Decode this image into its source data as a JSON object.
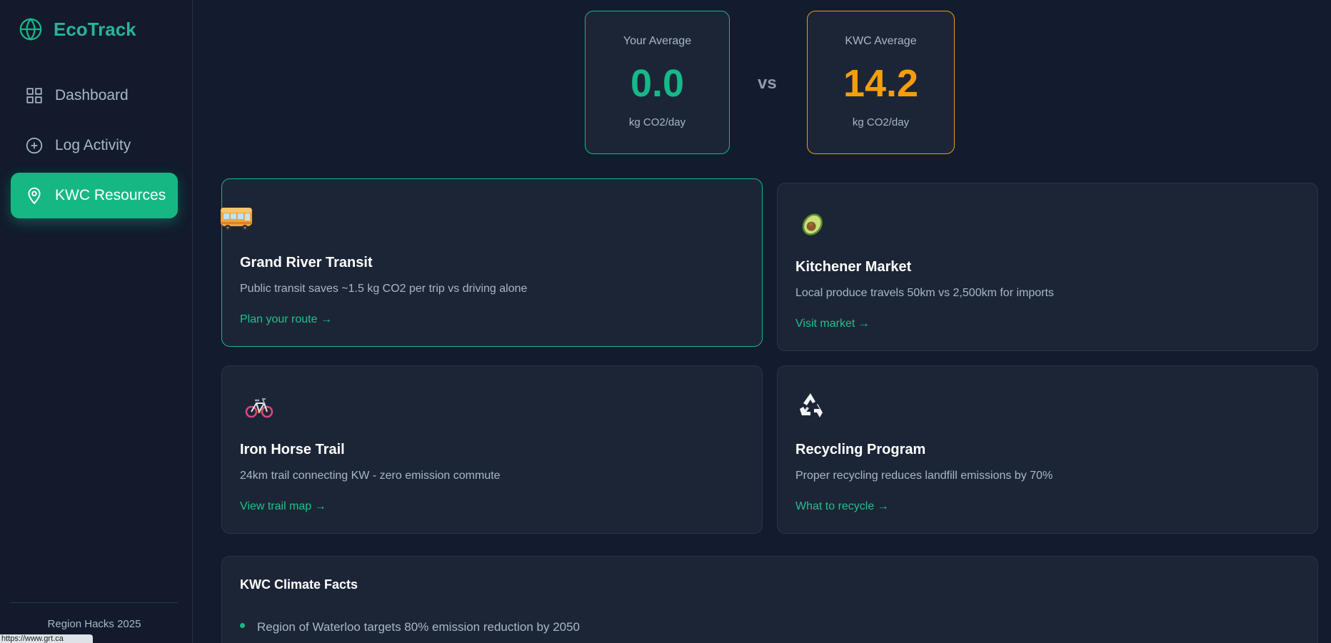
{
  "app": {
    "name": "EcoTrack"
  },
  "sidebar": {
    "items": [
      {
        "label": "Dashboard",
        "icon": "grid-icon",
        "active": false
      },
      {
        "label": "Log Activity",
        "icon": "plus-circle-icon",
        "active": false
      },
      {
        "label": "KWC Resources",
        "icon": "map-pin-icon",
        "active": true
      }
    ],
    "footer": "Region Hacks 2025"
  },
  "status_bar": {
    "url": "https://www.grt.ca"
  },
  "comparison": {
    "you": {
      "label": "Your Average",
      "value": "0.0",
      "unit": "kg CO2/day"
    },
    "vs": "vs",
    "kwc": {
      "label": "KWC Average",
      "value": "14.2",
      "unit": "kg CO2/day"
    }
  },
  "resources": [
    {
      "icon": "bus-icon",
      "title": "Grand River Transit",
      "description": "Public transit saves ~1.5 kg CO2 per trip vs driving alone",
      "link": "Plan your route →"
    },
    {
      "icon": "avocado-icon",
      "title": "Kitchener Market",
      "description": "Local produce travels 50km vs 2,500km for imports",
      "link": "Visit market →"
    },
    {
      "icon": "bicycle-icon",
      "title": "Iron Horse Trail",
      "description": "24km trail connecting KW - zero emission commute",
      "link": "View trail map →"
    },
    {
      "icon": "recycle-icon",
      "title": "Recycling Program",
      "description": "Proper recycling reduces landfill emissions by 70%",
      "link": "What to recycle →"
    }
  ],
  "facts": {
    "title": "KWC Climate Facts",
    "items": [
      "Region of Waterloo targets 80% emission reduction by 2050"
    ]
  },
  "colors": {
    "accent": "#17b888",
    "warning": "#f59e0b",
    "background": "#131b2e",
    "card": "#1c2536"
  }
}
